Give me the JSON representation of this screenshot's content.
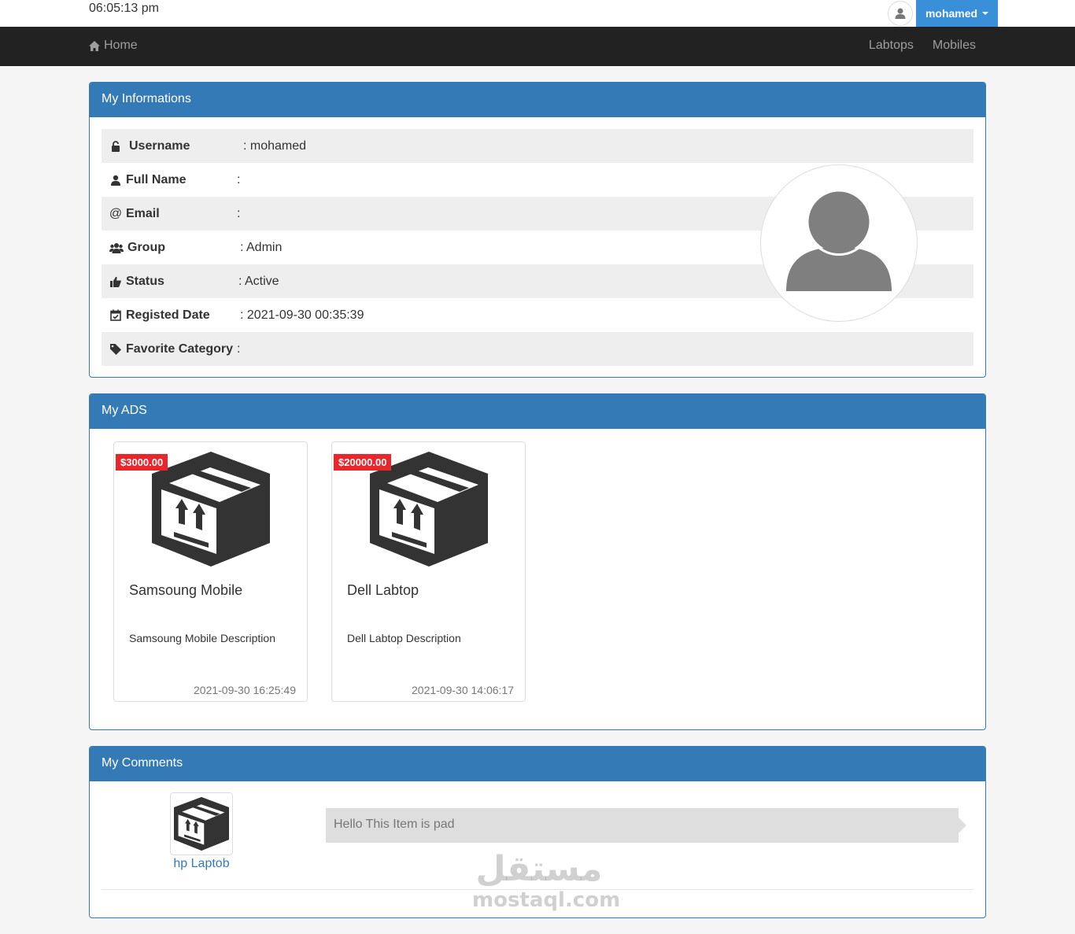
{
  "topbar": {
    "time": "06:05:13 pm",
    "user_label": "mohamed",
    "icons": {
      "avatar": "user-icon",
      "caret": "caret-down-icon"
    }
  },
  "nav": {
    "home_label": "Home",
    "home_icon": "home-icon",
    "links": [
      "Labtops",
      "Mobiles"
    ]
  },
  "info_panel": {
    "title": "My Informations",
    "rows": [
      {
        "label": "Username",
        "value": ": mohamed",
        "icon": "lock-icon"
      },
      {
        "label": "Full Name",
        "value": ":",
        "icon": "user-icon"
      },
      {
        "label": "Email",
        "value": ":",
        "icon": "at-icon"
      },
      {
        "label": "Group",
        "value": ": Admin",
        "icon": "users-icon"
      },
      {
        "label": "Status",
        "value": ": Active",
        "icon": "thumbs-up-icon"
      },
      {
        "label": "Registed Date",
        "value": ": 2021-09-30 00:35:39",
        "icon": "calendar-check-icon"
      },
      {
        "label": "Favorite Category",
        "value": ":",
        "icon": "tag-icon"
      }
    ]
  },
  "ads_panel": {
    "title": "My ADS",
    "ads": [
      {
        "price": "$3000.00",
        "title": "Samsoung Mobile",
        "description": "Samsoung Mobile Description",
        "date": "2021-09-30 16:25:49"
      },
      {
        "price": "$20000.00",
        "title": "Dell Labtop",
        "description": "Dell Labtop Description",
        "date": "2021-09-30 14:06:17"
      }
    ]
  },
  "comments_panel": {
    "title": "My Comments",
    "comments": [
      {
        "item": "hp Laptob",
        "text": "Hello This Item is pad"
      }
    ]
  },
  "watermark": {
    "arabic": "مستقل",
    "latin": "mostaql.com"
  },
  "colors": {
    "primary": "#337ab7",
    "navbar": "#222222",
    "price": "#e9262b",
    "user_button": "#3a8fd9"
  }
}
